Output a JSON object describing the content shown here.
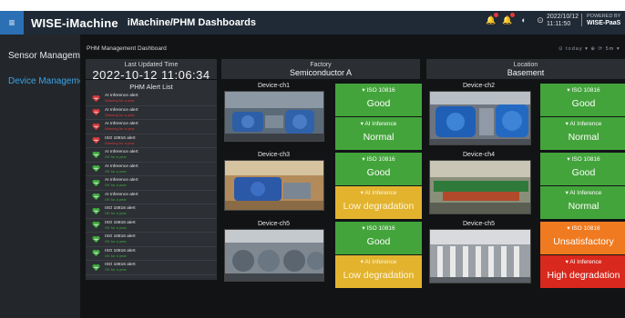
{
  "topbar": {
    "brand": "WISE-iMachine",
    "breadcrumb": "iMachine/PHM Dashboards",
    "date": "2022/10/12",
    "time": "11:11:50",
    "powered_line1": "POWERED BY",
    "powered_line2": "WISE-PaaS",
    "icons": [
      "bell-alert-icon",
      "bell-icon",
      "compass-icon",
      "settings-icon"
    ]
  },
  "sidebar": {
    "items": [
      {
        "label": "Sensor Management",
        "active": false
      },
      {
        "label": "Device Management",
        "active": true
      }
    ]
  },
  "dashboard": {
    "title": "PHM Management Dashboard",
    "tools": "⊙ today ▾  ⊕  ⟳  5m ▾"
  },
  "header_panels": {
    "updated": {
      "label": "Last Updated Time",
      "value": "2022-10-12 11:06:34"
    },
    "factory": {
      "label": "Factory",
      "value": "Semiconductor A"
    },
    "location": {
      "label": "Location",
      "value": "Basement"
    }
  },
  "alert_list": {
    "title": "PHM Alert List",
    "items": [
      {
        "title": "AI Inference alert",
        "status": "Warning for a year",
        "level": "bad"
      },
      {
        "title": "AI Inference alert",
        "status": "Warning for a year",
        "level": "bad"
      },
      {
        "title": "AI Inference alert",
        "status": "Warning for a year",
        "level": "bad"
      },
      {
        "title": "ISO 10816 alert",
        "status": "Warning for a year",
        "level": "bad"
      },
      {
        "title": "AI Inference alert",
        "status": "OK for a year",
        "level": "ok"
      },
      {
        "title": "AI Inference alert",
        "status": "OK for a year",
        "level": "ok"
      },
      {
        "title": "AI Inference alert",
        "status": "OK for a year",
        "level": "ok"
      },
      {
        "title": "AI Inference alert",
        "status": "OK for a year",
        "level": "ok"
      },
      {
        "title": "ISO 10816 alert",
        "status": "OK for a year",
        "level": "ok"
      },
      {
        "title": "ISO 10816 alert",
        "status": "OK for a year",
        "level": "ok"
      },
      {
        "title": "ISO 10816 alert",
        "status": "OK for a year",
        "level": "ok"
      },
      {
        "title": "ISO 10816 alert",
        "status": "OK for a year",
        "level": "ok"
      },
      {
        "title": "ISO 10816 alert",
        "status": "OK for a year",
        "level": "ok"
      }
    ]
  },
  "devices": [
    {
      "name": "Device-ch1",
      "iso_label": "▾ ISO 10816",
      "iso_value": "Good",
      "ai_label": "▾ AI Inference",
      "ai_value": "Normal"
    },
    {
      "name": "Device-ch2",
      "iso_label": "▾ ISO 10816",
      "iso_value": "Good",
      "ai_label": "▾ AI Inference",
      "ai_value": "Normal"
    },
    {
      "name": "Device-ch3",
      "iso_label": "▾ ISO 10816",
      "iso_value": "Good",
      "ai_label": "▾ AI Inference",
      "ai_value": "Low degradation"
    },
    {
      "name": "Device-ch4",
      "iso_label": "▾ ISO 10816",
      "iso_value": "Good",
      "ai_label": "▾ AI Inference",
      "ai_value": "Normal"
    },
    {
      "name": "Device-ch5",
      "iso_label": "▾ ISO 10816",
      "iso_value": "Good",
      "ai_label": "▾ AI Inference",
      "ai_value": "Low degradation"
    },
    {
      "name": "Device-ch5",
      "iso_label": "▾ ISO 10816",
      "iso_value": "Unsatisfactory",
      "ai_label": "▾ AI Inference",
      "ai_value": "High degradation"
    }
  ],
  "colors": {
    "good": "#43a43b",
    "low_degradation": "#e3b32e",
    "unsatisfactory": "#f07a1f",
    "high_degradation": "#d9281d",
    "alert_bad": "#d93a3a",
    "alert_ok": "#3fae3f"
  }
}
